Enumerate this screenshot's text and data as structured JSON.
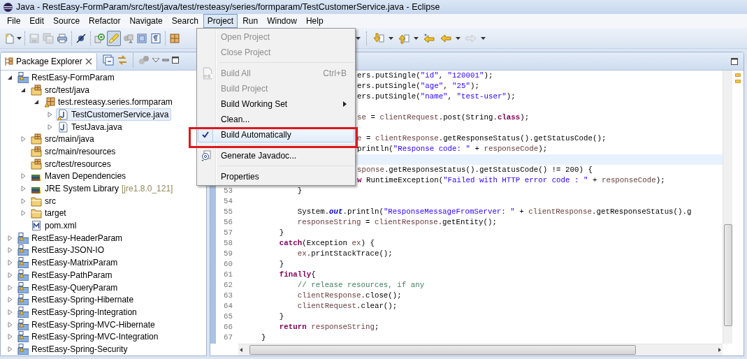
{
  "window": {
    "title": "Java - RestEasy-FormParam/src/test/java/test/resteasy/series/formparam/TestCustomerService.java - Eclipse"
  },
  "menubar": [
    {
      "label": "File",
      "selected": false
    },
    {
      "label": "Edit",
      "selected": false
    },
    {
      "label": "Source",
      "selected": false
    },
    {
      "label": "Refactor",
      "selected": false
    },
    {
      "label": "Navigate",
      "selected": false
    },
    {
      "label": "Search",
      "selected": false
    },
    {
      "label": "Project",
      "selected": true
    },
    {
      "label": "Run",
      "selected": false
    },
    {
      "label": "Window",
      "selected": false
    },
    {
      "label": "Help",
      "selected": false
    }
  ],
  "toolbar_left": [
    {
      "kind": "new",
      "pressed": false,
      "disabled": false
    },
    {
      "kind": "caret"
    },
    {
      "kind": "separator"
    },
    {
      "kind": "save",
      "pressed": false,
      "disabled": true
    },
    {
      "kind": "saveall",
      "pressed": false,
      "disabled": true
    },
    {
      "kind": "print",
      "pressed": false,
      "disabled": false
    },
    {
      "kind": "separator"
    },
    {
      "kind": "skip",
      "pressed": false,
      "disabled": false
    },
    {
      "kind": "separator"
    },
    {
      "kind": "newclass",
      "pressed": false,
      "disabled": false
    },
    {
      "kind": "brush",
      "pressed": true,
      "disabled": false
    },
    {
      "kind": "shapes",
      "pressed": false,
      "disabled": false
    },
    {
      "kind": "block",
      "pressed": false,
      "disabled": false
    },
    {
      "kind": "para",
      "pressed": false,
      "disabled": false
    },
    {
      "kind": "separator"
    },
    {
      "kind": "package",
      "pressed": false,
      "disabled": false
    }
  ],
  "toolbar_right": [
    {
      "kind": "caret"
    },
    {
      "kind": "separator"
    },
    {
      "kind": "down",
      "pressed": false,
      "disabled": false
    },
    {
      "kind": "caret"
    },
    {
      "kind": "up",
      "pressed": false,
      "disabled": false
    },
    {
      "kind": "caret"
    },
    {
      "kind": "lastedit",
      "pressed": false,
      "disabled": false
    },
    {
      "kind": "back",
      "pressed": false,
      "disabled": false
    },
    {
      "kind": "caret"
    },
    {
      "kind": "forward",
      "pressed": false,
      "disabled": true
    },
    {
      "kind": "caret"
    }
  ],
  "explorer": {
    "tab": {
      "label": "Package Explorer",
      "selected": true
    },
    "tree": [
      {
        "label": "RestEasy-FormParam",
        "kind": "project",
        "expanded": true,
        "selected": false,
        "children": [
          {
            "label": "src/test/java",
            "kind": "srcfolder",
            "expanded": true,
            "selected": false,
            "children": [
              {
                "label": "test.resteasy.series.formparam",
                "kind": "package",
                "expanded": true,
                "selected": false,
                "children": [
                  {
                    "label": "TestCustomerService.java",
                    "kind": "javawarn",
                    "expanded": false,
                    "selected": true
                  },
                  {
                    "label": "TestJava.java",
                    "kind": "java",
                    "expanded": false,
                    "selected": false
                  }
                ]
              }
            ]
          },
          {
            "label": "src/main/java",
            "kind": "srcfolder",
            "expanded": false,
            "selected": false
          },
          {
            "label": "src/main/resources",
            "kind": "srcfolder",
            "selected": false
          },
          {
            "label": "src/test/resources",
            "kind": "srcfolder",
            "selected": false
          },
          {
            "label": "Maven Dependencies",
            "kind": "library",
            "expanded": false,
            "selected": false
          },
          {
            "label": "JRE System Library",
            "decoration": "[jre1.8.0_121]",
            "kind": "library",
            "expanded": false,
            "selected": false
          },
          {
            "label": "src",
            "kind": "folder",
            "expanded": false,
            "selected": false
          },
          {
            "label": "target",
            "kind": "folder",
            "expanded": false,
            "selected": false
          },
          {
            "label": "pom.xml",
            "kind": "xml",
            "selected": false
          }
        ]
      },
      {
        "label": "RestEasy-HeaderParam",
        "kind": "project",
        "expanded": false,
        "selected": false
      },
      {
        "label": "RestEasy-JSON-IO",
        "kind": "project",
        "expanded": false,
        "selected": false
      },
      {
        "label": "RestEasy-MatrixParam",
        "kind": "project",
        "expanded": false,
        "selected": false
      },
      {
        "label": "RestEasy-PathParam",
        "kind": "project",
        "expanded": false,
        "selected": false
      },
      {
        "label": "RestEasy-QueryParam",
        "kind": "project",
        "expanded": false,
        "selected": false
      },
      {
        "label": "RestEasy-Spring-Hibernate",
        "kind": "project",
        "expanded": false,
        "selected": false
      },
      {
        "label": "RestEasy-Spring-Integration",
        "kind": "project",
        "expanded": false,
        "selected": false
      },
      {
        "label": "RestEasy-Spring-MVC-Hibernate",
        "kind": "project",
        "expanded": false,
        "selected": false
      },
      {
        "label": "RestEasy-Spring-MVC-Integration",
        "kind": "project",
        "expanded": false,
        "selected": false
      },
      {
        "label": "RestEasy-Spring-Security",
        "kind": "project",
        "expanded": false,
        "selected": false
      }
    ]
  },
  "editor": {
    "lines": [
      {
        "kind": "covered",
        "current": false,
        "tokens": [
          {
            "kind": "plain",
            "text": "ers.putSingle("
          },
          {
            "kind": "string",
            "text": "\"id\""
          },
          {
            "kind": "plain",
            "text": ", "
          },
          {
            "kind": "string",
            "text": "\"120001\""
          },
          {
            "kind": "plain",
            "text": ");"
          }
        ]
      },
      {
        "kind": "covered",
        "current": false,
        "tokens": [
          {
            "kind": "plain",
            "text": "ers.putSingle("
          },
          {
            "kind": "string",
            "text": "\"age\""
          },
          {
            "kind": "plain",
            "text": ", "
          },
          {
            "kind": "string",
            "text": "\"25\""
          },
          {
            "kind": "plain",
            "text": ");"
          }
        ]
      },
      {
        "kind": "covered",
        "current": false,
        "tokens": [
          {
            "kind": "plain",
            "text": "ers.putSingle("
          },
          {
            "kind": "string",
            "text": "\"name\""
          },
          {
            "kind": "plain",
            "text": ", "
          },
          {
            "kind": "string",
            "text": "\"test-user\""
          },
          {
            "kind": "plain",
            "text": ");"
          }
        ]
      },
      {
        "kind": "covered",
        "current": false
      },
      {
        "kind": "covered",
        "current": false,
        "tokens": [
          {
            "kind": "variable",
            "text": "se"
          },
          {
            "kind": "plain",
            "text": " = "
          },
          {
            "kind": "variable",
            "text": "clientRequest"
          },
          {
            "kind": "plain",
            "text": ".post(String."
          },
          {
            "kind": "keyword",
            "text": "class"
          },
          {
            "kind": "plain",
            "text": ");"
          }
        ]
      },
      {
        "kind": "covered",
        "current": false
      },
      {
        "kind": "covered",
        "current": false,
        "tokens": [
          {
            "kind": "variable",
            "text": "e"
          },
          {
            "kind": "plain",
            "text": " = "
          },
          {
            "kind": "variable",
            "text": "clientResponse"
          },
          {
            "kind": "plain",
            "text": ".getResponseStatus().getStatusCode();"
          }
        ]
      },
      {
        "kind": "covered",
        "current": false,
        "tokens": [
          {
            "kind": "plain",
            "text": "println("
          },
          {
            "kind": "string",
            "text": "\"Response code: \""
          },
          {
            "kind": "plain",
            "text": " + "
          },
          {
            "kind": "variable",
            "text": "responseCode"
          },
          {
            "kind": "plain",
            "text": ");"
          }
        ]
      },
      {
        "kind": "covered",
        "current": true
      },
      {
        "kind": "covered",
        "current": false,
        "tokens": [
          {
            "kind": "variable",
            "text": "sponse"
          },
          {
            "kind": "plain",
            "text": ".getResponseStatus().getStatusCode() != 200) {"
          }
        ]
      },
      {
        "kind": "covered",
        "current": false,
        "tokens": [
          {
            "kind": "keyword",
            "text": "w"
          },
          {
            "kind": "plain",
            "text": " RuntimeException("
          },
          {
            "kind": "string",
            "text": "\"Failed with HTTP error code : \""
          },
          {
            "kind": "plain",
            "text": " + "
          },
          {
            "kind": "variable",
            "text": "responseCode"
          },
          {
            "kind": "plain",
            "text": ");"
          }
        ]
      },
      {
        "kind": "full",
        "number": "53",
        "current": false,
        "tokens": [
          {
            "kind": "plain",
            "text": "            }"
          }
        ]
      },
      {
        "kind": "full",
        "number": "54",
        "current": false
      },
      {
        "kind": "full",
        "number": "55",
        "current": false,
        "tokens": [
          {
            "kind": "plain",
            "text": "            System."
          },
          {
            "kind": "field",
            "text": "out"
          },
          {
            "kind": "plain",
            "text": ".println("
          },
          {
            "kind": "string",
            "text": "\"ResponseMessageFromServer: \""
          },
          {
            "kind": "plain",
            "text": " + "
          },
          {
            "kind": "variable",
            "text": "clientResponse"
          },
          {
            "kind": "plain",
            "text": ".getResponseStatus().g"
          }
        ]
      },
      {
        "kind": "full",
        "number": "56",
        "current": false,
        "tokens": [
          {
            "kind": "variable",
            "text": "            responseString"
          },
          {
            "kind": "plain",
            "text": " = "
          },
          {
            "kind": "variable",
            "text": "clientResponse"
          },
          {
            "kind": "plain",
            "text": ".getEntity();"
          }
        ]
      },
      {
        "kind": "full",
        "number": "57",
        "current": false,
        "tokens": [
          {
            "kind": "plain",
            "text": "        }"
          }
        ]
      },
      {
        "kind": "full",
        "number": "58",
        "current": false,
        "tokens": [
          {
            "kind": "keyword",
            "text": "        catch"
          },
          {
            "kind": "plain",
            "text": "(Exception "
          },
          {
            "kind": "variable",
            "text": "ex"
          },
          {
            "kind": "plain",
            "text": ") {"
          }
        ]
      },
      {
        "kind": "full",
        "number": "59",
        "current": false,
        "tokens": [
          {
            "kind": "variable",
            "text": "            ex"
          },
          {
            "kind": "plain",
            "text": ".printStackTrace();"
          }
        ]
      },
      {
        "kind": "full",
        "number": "60",
        "current": false,
        "tokens": [
          {
            "kind": "plain",
            "text": "        }"
          }
        ]
      },
      {
        "kind": "full",
        "number": "61",
        "current": false,
        "tokens": [
          {
            "kind": "keyword",
            "text": "        finally"
          },
          {
            "kind": "plain",
            "text": "{"
          }
        ]
      },
      {
        "kind": "full",
        "number": "62",
        "current": false,
        "tokens": [
          {
            "kind": "comment",
            "text": "            // release resources, if any"
          }
        ]
      },
      {
        "kind": "full",
        "number": "63",
        "current": false,
        "tokens": [
          {
            "kind": "variable",
            "text": "            clientResponse"
          },
          {
            "kind": "plain",
            "text": ".close();"
          }
        ]
      },
      {
        "kind": "full",
        "number": "64",
        "current": false,
        "tokens": [
          {
            "kind": "variable",
            "text": "            clientRequest"
          },
          {
            "kind": "plain",
            "text": ".clear();"
          }
        ]
      },
      {
        "kind": "full",
        "number": "65",
        "current": false,
        "tokens": [
          {
            "kind": "plain",
            "text": "        }"
          }
        ]
      },
      {
        "kind": "full",
        "number": "66",
        "current": false,
        "tokens": [
          {
            "kind": "keyword",
            "text": "        return"
          },
          {
            "kind": "variable",
            "text": " responseString"
          },
          {
            "kind": "plain",
            "text": ";"
          }
        ]
      },
      {
        "kind": "full",
        "number": "67",
        "current": false,
        "tokens": [
          {
            "kind": "plain",
            "text": "    }"
          }
        ]
      }
    ]
  },
  "project_menu": [
    {
      "kind": "plain",
      "label": "Open Project",
      "disabled": true,
      "hovered": false
    },
    {
      "kind": "plain",
      "label": "Close Project",
      "disabled": true,
      "hovered": false
    },
    {
      "kind": "separator"
    },
    {
      "kind": "binary",
      "label": "Build All",
      "shortcut": "Ctrl+B",
      "disabled": true,
      "hovered": false
    },
    {
      "kind": "plain",
      "label": "Build Project",
      "disabled": true,
      "hovered": false
    },
    {
      "kind": "plain",
      "label": "Build Working Set",
      "disabled": false,
      "hovered": false,
      "submenu": true
    },
    {
      "kind": "plain",
      "label": "Clean...",
      "disabled": false,
      "hovered": false
    },
    {
      "kind": "plain",
      "label": "Build Automatically",
      "disabled": false,
      "hovered": true,
      "checked": true,
      "annotated": true
    },
    {
      "kind": "separator"
    },
    {
      "kind": "javadoc",
      "label": "Generate Javadoc...",
      "disabled": false,
      "hovered": false
    },
    {
      "kind": "separator"
    },
    {
      "kind": "plain",
      "label": "Properties",
      "disabled": false,
      "hovered": false
    }
  ]
}
